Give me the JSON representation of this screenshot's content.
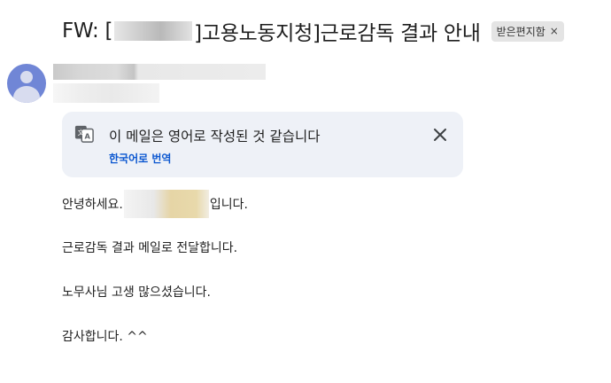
{
  "email": {
    "subject_prefix": "FW: [",
    "subject_suffix": "]고용노동지청]근로감독 결과 안내",
    "label_chip": "받은편지함",
    "label_chip_close": "×"
  },
  "translate_banner": {
    "title": "이 메일은 영어로 작성된 것 같습니다",
    "action_link": "한국어로 번역"
  },
  "body": {
    "line1_prefix": "안녕하세요. ",
    "line1_suffix": "입니다.",
    "line2": "근로감독 결과 메일로 전달합니다.",
    "line3": "노무사님 고생 많으셨습니다.",
    "line4": "감사합니다. ^^"
  },
  "colors": {
    "link": "#0b57d0",
    "banner_bg": "#eef1f7",
    "avatar": "#7086d6",
    "chip_bg": "#e4e4e4"
  },
  "icons": {
    "translate": "translate-icon",
    "close": "close-icon",
    "avatar": "person-icon"
  }
}
